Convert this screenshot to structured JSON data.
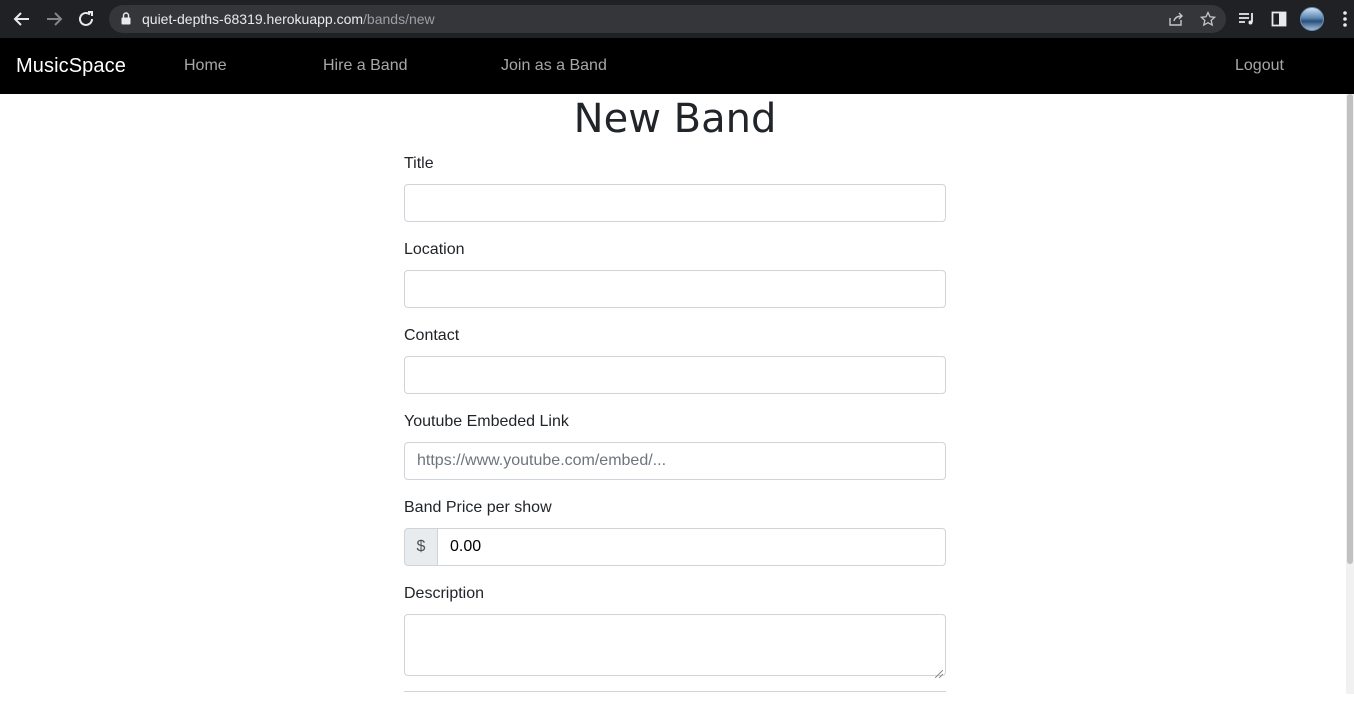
{
  "browser": {
    "url_host": "quiet-depths-68319.herokuapp.com",
    "url_path": "/bands/new"
  },
  "navbar": {
    "brand": "MusicSpace",
    "links": [
      {
        "label": "Home"
      },
      {
        "label": "Hire a Band"
      },
      {
        "label": "Join as a Band"
      }
    ],
    "logout": "Logout"
  },
  "form": {
    "heading": "New Band",
    "title_label": "Title",
    "location_label": "Location",
    "contact_label": "Contact",
    "youtube_label": "Youtube Embeded Link",
    "youtube_placeholder": "https://www.youtube.com/embed/...",
    "price_label": "Band Price per show",
    "price_prefix": "$",
    "price_placeholder": "0.00",
    "description_label": "Description"
  }
}
